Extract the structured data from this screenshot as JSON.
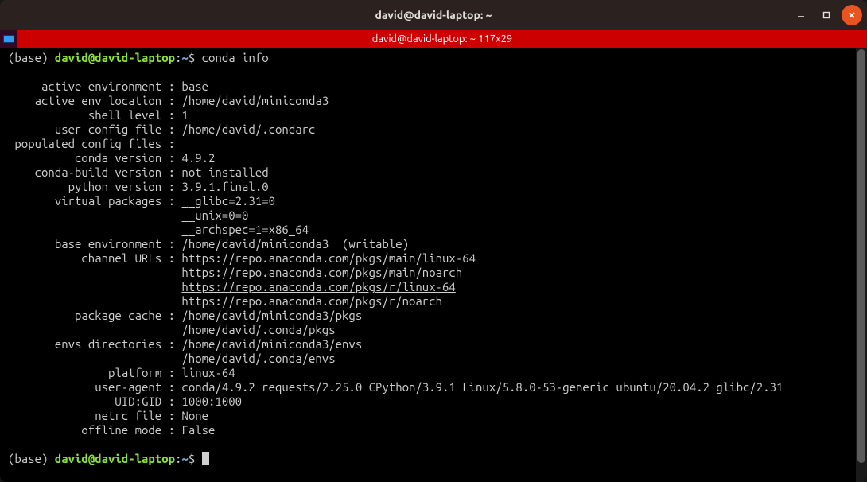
{
  "window": {
    "title": "david@david-laptop: ~"
  },
  "tab": {
    "title": "david@david-laptop: ~ 117x29"
  },
  "prompt": {
    "env_prefix": "(base)",
    "userhost": "david@david-laptop",
    "cwd": "~",
    "symbol": "$",
    "command": "conda info"
  },
  "info": {
    "active_environment": {
      "label": "active environment",
      "value": "base"
    },
    "active_env_location": {
      "label": "active env location",
      "value": "/home/david/miniconda3"
    },
    "shell_level": {
      "label": "shell level",
      "value": "1"
    },
    "user_config_file": {
      "label": "user config file",
      "value": "/home/david/.condarc"
    },
    "populated_config_files": {
      "label": "populated config files",
      "value": ""
    },
    "conda_version": {
      "label": "conda version",
      "value": "4.9.2"
    },
    "conda_build_version": {
      "label": "conda-build version",
      "value": "not installed"
    },
    "python_version": {
      "label": "python version",
      "value": "3.9.1.final.0"
    },
    "virtual_packages": {
      "label": "virtual packages",
      "value": "__glibc=2.31=0",
      "extra1": "__unix=0=0",
      "extra2": "__archspec=1=x86_64"
    },
    "base_environment": {
      "label": "base environment",
      "value": "/home/david/miniconda3  (writable)"
    },
    "channel_urls": {
      "label": "channel URLs",
      "value": "https://repo.anaconda.com/pkgs/main/linux-64",
      "extra1": "https://repo.anaconda.com/pkgs/main/noarch",
      "extra2": "https://repo.anaconda.com/pkgs/r/linux-64",
      "extra3": "https://repo.anaconda.com/pkgs/r/noarch"
    },
    "package_cache": {
      "label": "package cache",
      "value": "/home/david/miniconda3/pkgs",
      "extra1": "/home/david/.conda/pkgs"
    },
    "envs_directories": {
      "label": "envs directories",
      "value": "/home/david/miniconda3/envs",
      "extra1": "/home/david/.conda/envs"
    },
    "platform": {
      "label": "platform",
      "value": "linux-64"
    },
    "user_agent": {
      "label": "user-agent",
      "value": "conda/4.9.2 requests/2.25.0 CPython/3.9.1 Linux/5.8.0-53-generic ubuntu/20.04.2 glibc/2.31"
    },
    "uid_gid": {
      "label": "UID:GID",
      "value": "1000:1000"
    },
    "netrc_file": {
      "label": "netrc file",
      "value": "None"
    },
    "offline_mode": {
      "label": "offline mode",
      "value": "False"
    }
  }
}
